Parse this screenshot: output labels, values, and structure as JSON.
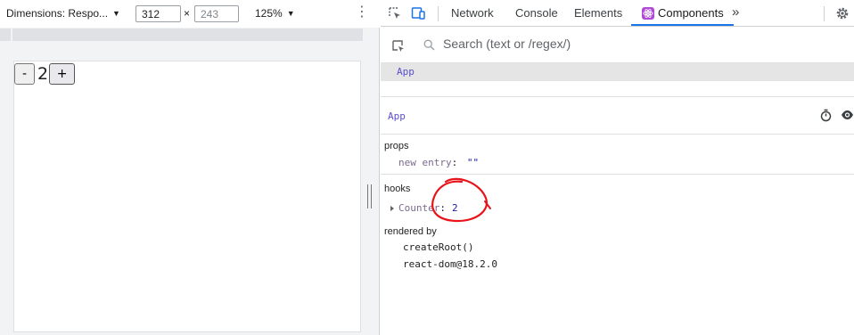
{
  "device_toolbar": {
    "dimensions_label": "Dimensions: Respo...",
    "width": "312",
    "height": "243",
    "times": "×",
    "zoom": "125%",
    "caret": "▼",
    "more": "⋮"
  },
  "app": {
    "minus_label": "-",
    "count": "2",
    "plus_label": "+"
  },
  "devtools": {
    "tabs": [
      {
        "label": "Network"
      },
      {
        "label": "Console"
      },
      {
        "label": "Elements"
      },
      {
        "label": "Components"
      }
    ],
    "more_tabs": "»",
    "search_placeholder": "Search (text or /regex/)",
    "tree_root": "App",
    "selected_component": "App",
    "props_label": "props",
    "props": [
      {
        "name": "new entry",
        "colon": ":",
        "value": "\"\""
      }
    ],
    "hooks_label": "hooks",
    "hooks": [
      {
        "name": "Counter",
        "colon": ":",
        "value": "2"
      }
    ],
    "rendered_by_label": "rendered by",
    "rendered_by": [
      "createRoot()",
      "react-dom@18.2.0"
    ]
  },
  "colors": {
    "active_tab_accent": "#1a73e8",
    "annotation": "#e8141a",
    "component_name": "#5a4fcf"
  },
  "icons": [
    "inspect-element-icon",
    "device-toggle-icon",
    "react-icon",
    "settings-gear-icon",
    "select-component-icon",
    "search-icon",
    "stopwatch-icon",
    "eye-icon",
    "expand-triangle-icon"
  ]
}
